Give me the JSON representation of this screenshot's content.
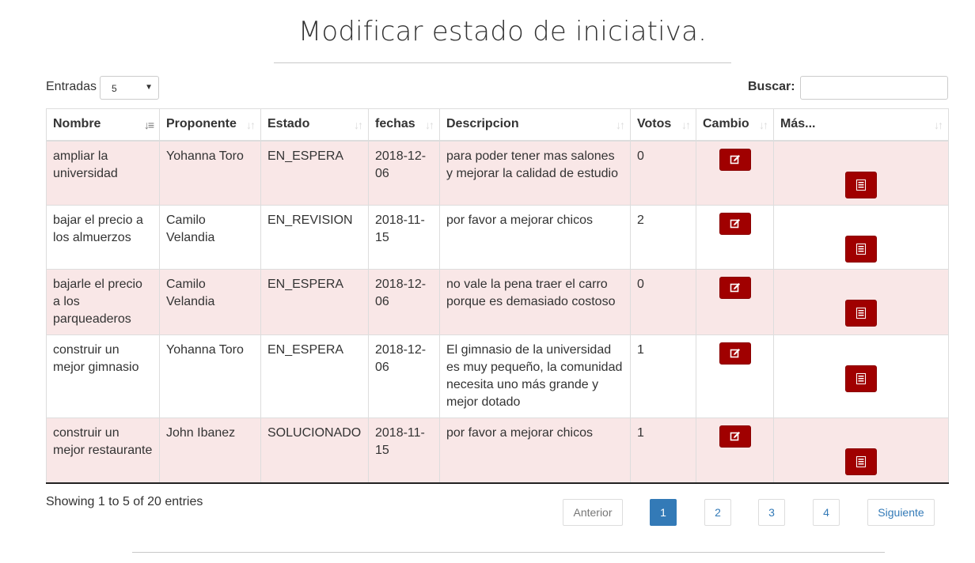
{
  "page_title": "Modificar estado de iniciativa.",
  "length": {
    "label": "Entradas",
    "value": "5"
  },
  "search": {
    "label": "Buscar:",
    "value": ""
  },
  "columns": [
    "Nombre",
    "Proponente",
    "Estado",
    "fechas",
    "Descripcion",
    "Votos",
    "Cambio",
    "Más..."
  ],
  "sorted_column": "Nombre",
  "rows": [
    {
      "nombre": "ampliar la universidad",
      "proponente": "Yohanna Toro",
      "estado": "EN_ESPERA",
      "fecha": "2018-12-06",
      "descripcion": "para poder tener mas salones y mejorar la calidad de estudio",
      "votos": "0"
    },
    {
      "nombre": "bajar el precio a los almuerzos",
      "proponente": "Camilo Velandia",
      "estado": "EN_REVISION",
      "fecha": "2018-11-15",
      "descripcion": "por favor a mejorar chicos",
      "votos": "2"
    },
    {
      "nombre": "bajarle el precio a los parqueaderos",
      "proponente": "Camilo Velandia",
      "estado": "EN_ESPERA",
      "fecha": "2018-12-06",
      "descripcion": "no vale la pena traer el carro porque es demasiado costoso",
      "votos": "0"
    },
    {
      "nombre": "construir un mejor gimnasio",
      "proponente": "Yohanna Toro",
      "estado": "EN_ESPERA",
      "fecha": "2018-12-06",
      "descripcion": "El gimnasio de la universidad es muy pequeño, la comunidad necesita uno más grande y mejor dotado",
      "votos": "1"
    },
    {
      "nombre": "construir un mejor restaurante",
      "proponente": "John Ibanez",
      "estado": "SOLUCIONADO",
      "fecha": "2018-11-15",
      "descripcion": "por favor a mejorar chicos",
      "votos": "1"
    }
  ],
  "info": "Showing 1 to 5 of 20 entries",
  "pagination": {
    "previous": "Anterior",
    "pages": [
      "1",
      "2",
      "3",
      "4"
    ],
    "current": "1",
    "next": "Siguiente"
  },
  "colors": {
    "accent_button": "#a00000",
    "row_tint": "#f9e7e7",
    "pagination_active": "#337ab7"
  },
  "icons": {
    "edit": "edit-icon",
    "details": "list-icon",
    "sort": "sort-icon"
  }
}
